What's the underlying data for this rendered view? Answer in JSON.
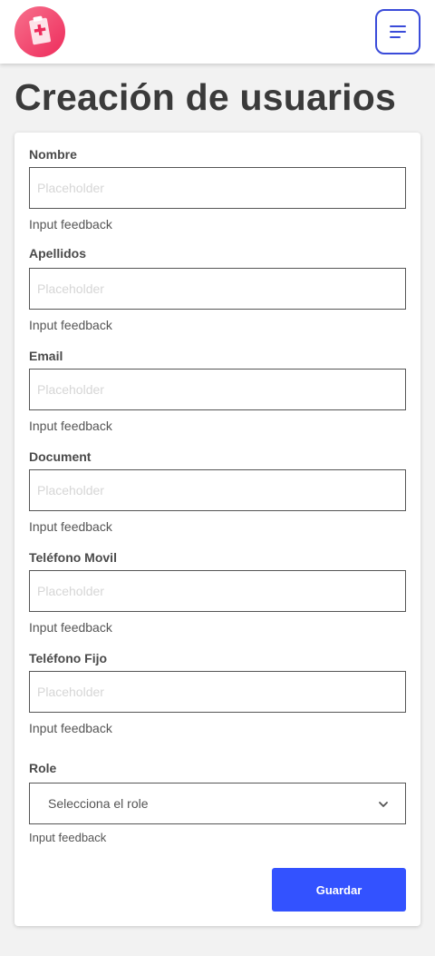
{
  "header": {
    "logo_icon": "medical-clipboard-icon",
    "menu_icon": "hamburger-menu-icon",
    "accent_color": "#3a4bd9",
    "logo_color": "#f0446c"
  },
  "page": {
    "title": "Creación de usuarios"
  },
  "form": {
    "fields": [
      {
        "label": "Nombre",
        "placeholder": "Placeholder",
        "value": "",
        "feedback": "Input feedback"
      },
      {
        "label": "Apellidos",
        "placeholder": "Placeholder",
        "value": "",
        "feedback": "Input feedback"
      },
      {
        "label": "Email",
        "placeholder": "Placeholder",
        "value": "",
        "feedback": "Input feedback"
      },
      {
        "label": "Document",
        "placeholder": "Placeholder",
        "value": "",
        "feedback": "Input feedback"
      },
      {
        "label": "Teléfono Movil",
        "placeholder": "Placeholder",
        "value": "",
        "feedback": "Input feedback"
      },
      {
        "label": "Teléfono Fijo",
        "placeholder": "Placeholder",
        "value": "",
        "feedback": "Input feedback"
      }
    ],
    "role": {
      "label": "Role",
      "selected": "Selecciona el role",
      "feedback": "Input feedback",
      "icon": "chevron-down-icon"
    },
    "submit_label": "Guardar",
    "submit_color": "#3352ff"
  }
}
